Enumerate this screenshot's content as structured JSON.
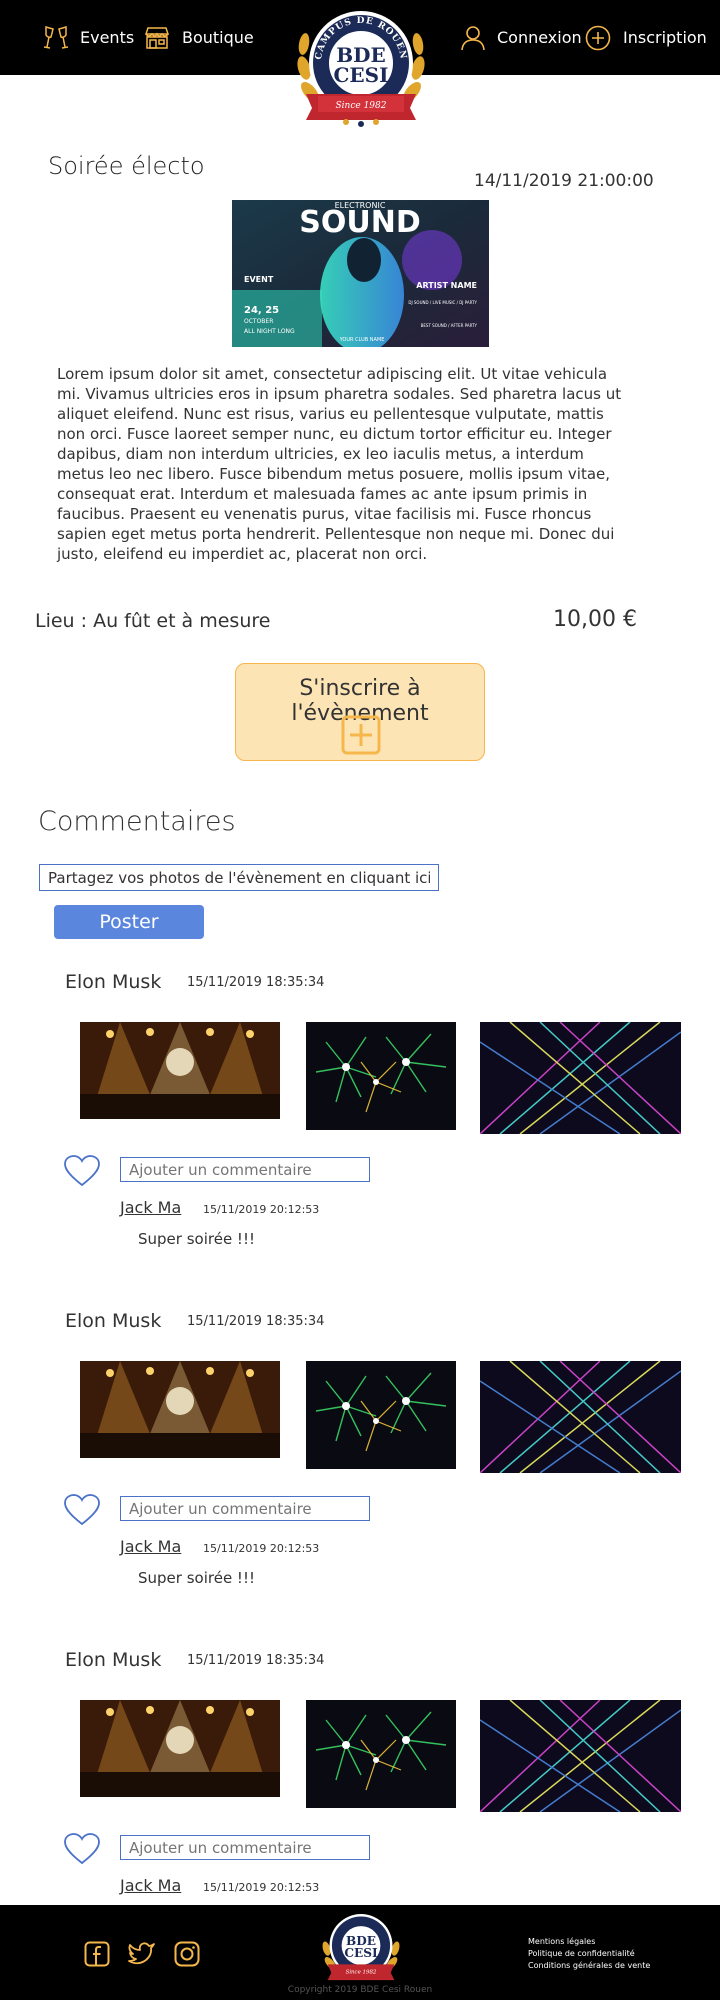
{
  "nav": {
    "events": "Events",
    "shop": "Boutique",
    "login": "Connexion",
    "signup": "Inscription"
  },
  "logo": {
    "top_text": "CAMPUS DE ROUEN",
    "line1": "BDE",
    "line2": "CESI",
    "since": "Since 1982"
  },
  "event": {
    "title": "Soirée électo",
    "datetime": "14/11/2019 21:00:00",
    "poster": {
      "headline": "ELECTRONIC",
      "title": "SOUND",
      "event_label": "EVENT",
      "dates": "24, 25",
      "month": "OCTOBER",
      "all_night": "ALL NIGHT LONG",
      "artist": "ARTIST NAME",
      "features": "DJ SOUND / LIVE MUSIC / DJ PARTY",
      "extras": "BEST SOUND / AFTER PARTY",
      "club": "YOUR CLUB NAME"
    },
    "description": "Lorem ipsum dolor sit amet, consectetur adipiscing elit. Ut vitae vehicula mi. Vivamus ultricies eros in ipsum pharetra sodales. Sed pharetra lacus ut aliquet eleifend. Nunc est risus, varius eu pellentesque vulputate, mattis non orci. Fusce laoreet semper nunc, eu dictum tortor efficitur eu. Integer dapibus, diam non interdum ultricies, ex leo iaculis metus, a interdum metus leo nec libero. Fusce bibendum metus posuere, mollis ipsum vitae, consequat erat. Interdum et malesuada fames ac ante ipsum primis in faucibus. Praesent eu venenatis purus, vitae facilisis mi. Fusce rhoncus sapien eget metus porta hendrerit. Pellentesque non neque mi. Donec dui justo, eleifend eu imperdiet ac, placerat non orci.",
    "place": "Lieu : Au fût et à mesure",
    "price": "10,00 €",
    "signup_label": "S'inscrire à l'évènement"
  },
  "comments_section": {
    "title": "Commentaires",
    "photo_input_value": "Partagez vos photos de l'évènement en cliquant ici !",
    "post_label": "Poster",
    "reply_placeholder": "Ajouter un commentaire"
  },
  "comments": [
    {
      "author": "Elon Musk",
      "date": "15/11/2019 18:35:34",
      "reply": {
        "author": "Jack Ma",
        "date": "15/11/2019 20:12:53",
        "text": "Super soirée !!!"
      }
    },
    {
      "author": "Elon Musk",
      "date": "15/11/2019 18:35:34",
      "reply": {
        "author": "Jack Ma",
        "date": "15/11/2019 20:12:53",
        "text": "Super soirée !!!"
      }
    },
    {
      "author": "Elon Musk",
      "date": "15/11/2019 18:35:34",
      "reply": {
        "author": "Jack Ma",
        "date": "15/11/2019 20:12:53",
        "text": ""
      }
    }
  ],
  "footer": {
    "legal": [
      "Mentions légales",
      "Politique de confidentialité",
      "Conditions générales de vente"
    ],
    "copyright": "Copyright 2019 BDE Cesi Rouen"
  },
  "colors": {
    "accent": "#f5b74b",
    "link_blue": "#4a72c9",
    "button_blue": "#5b86dd",
    "header_bg": "#000000"
  }
}
